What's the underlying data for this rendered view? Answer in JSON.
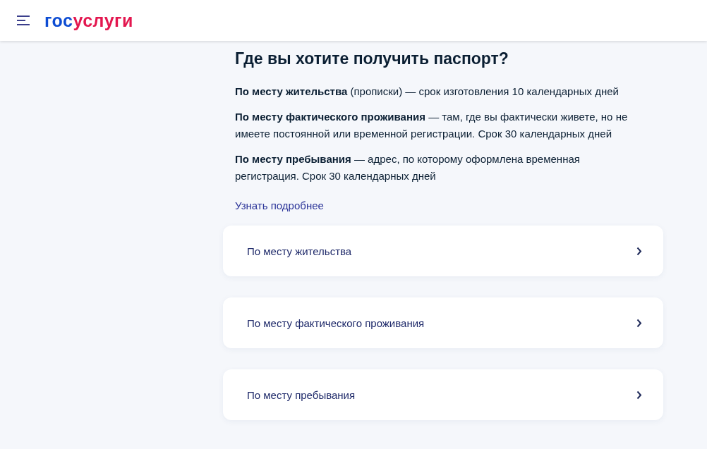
{
  "header": {
    "logo": {
      "prefix": "гос",
      "suffix": "услуги"
    }
  },
  "title": "Где вы хотите получить паспорт?",
  "paragraphs": [
    "**По месту жительства** (прописки) — срок изготовления 10 календарных дней",
    "**По месту фактического проживания** — там, где вы фактически живете, но не имеете постоянной или временной регистрации. Срок 30 календарных дней",
    "**По месту пребывания** — адрес, по которому оформлена временная регистрация. Срок 30 календарных дней"
  ],
  "more_link": "Узнать подробнее",
  "options": [
    {
      "label": "По месту жительства"
    },
    {
      "label": "По месту фактического проживания"
    },
    {
      "label": "По месту пребывания"
    }
  ]
}
